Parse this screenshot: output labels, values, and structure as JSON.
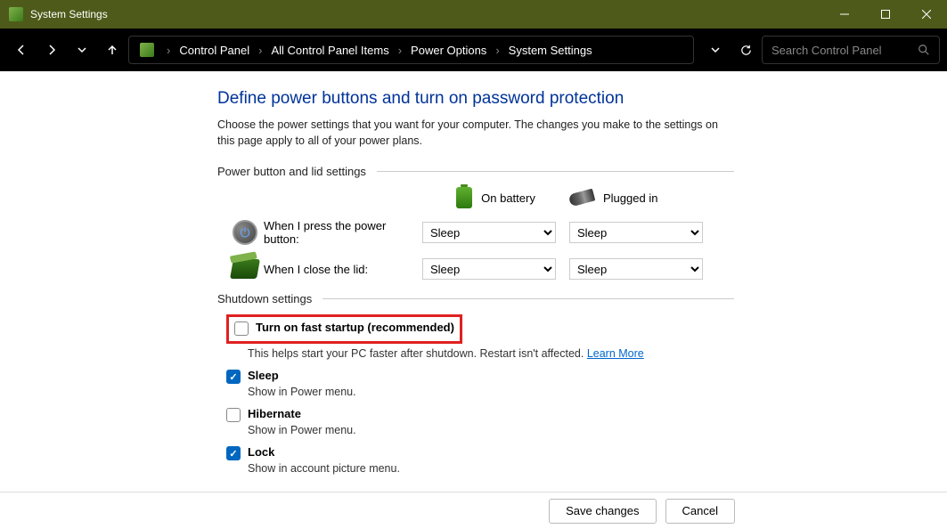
{
  "window": {
    "title": "System Settings"
  },
  "breadcrumb": {
    "items": [
      "Control Panel",
      "All Control Panel Items",
      "Power Options",
      "System Settings"
    ]
  },
  "search": {
    "placeholder": "Search Control Panel"
  },
  "page": {
    "heading": "Define power buttons and turn on password protection",
    "subtext": "Choose the power settings that you want for your computer. The changes you make to the settings on this page apply to all of your power plans."
  },
  "section1": {
    "title": "Power button and lid settings",
    "col_battery": "On battery",
    "col_plugged": "Plugged in",
    "rows": [
      {
        "label": "When I press the power button:",
        "battery": "Sleep",
        "plugged": "Sleep"
      },
      {
        "label": "When I close the lid:",
        "battery": "Sleep",
        "plugged": "Sleep"
      }
    ]
  },
  "section2": {
    "title": "Shutdown settings",
    "items": [
      {
        "label": "Turn on fast startup (recommended)",
        "checked": false,
        "desc": "This helps start your PC faster after shutdown. Restart isn't affected. ",
        "link": "Learn More"
      },
      {
        "label": "Sleep",
        "checked": true,
        "desc": "Show in Power menu."
      },
      {
        "label": "Hibernate",
        "checked": false,
        "desc": "Show in Power menu."
      },
      {
        "label": "Lock",
        "checked": true,
        "desc": "Show in account picture menu."
      }
    ]
  },
  "footer": {
    "save": "Save changes",
    "cancel": "Cancel"
  }
}
